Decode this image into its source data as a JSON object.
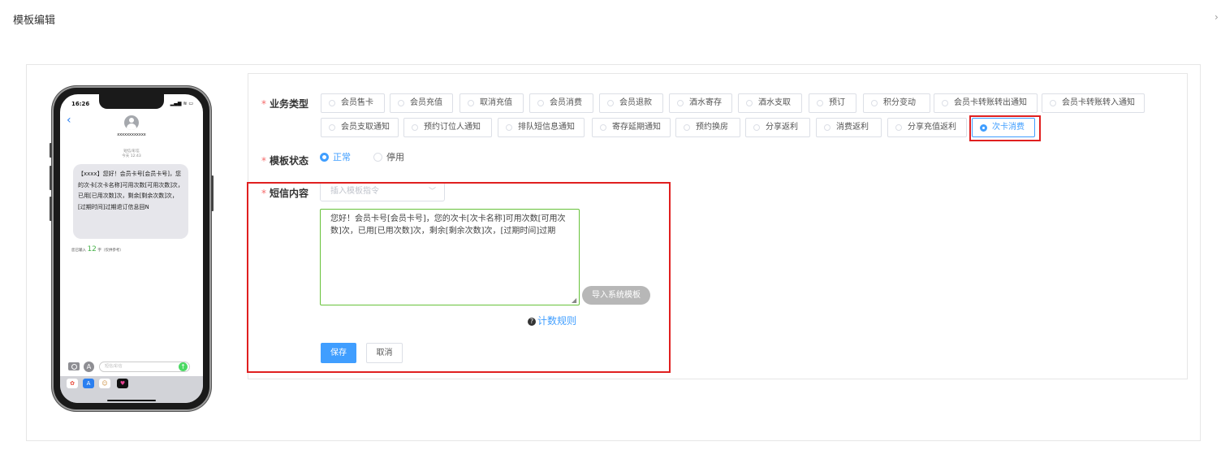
{
  "page": {
    "title": "模板编辑"
  },
  "preview": {
    "status_time": "16:26",
    "status_icons": "▂▄▆ ≋ ▭",
    "contact_name": "xxxxxxxxxxxx",
    "sms_meta_line1": "短信/彩信",
    "sms_meta_line2": "今天 12:43",
    "message": "【xxxx】您好！会员卡号[会员卡号]，您的次卡[次卡名称]可用次数[可用次数]次，已用[已用次数]次，剩余[剩余次数]次，[过期时间]过期退订信息回N",
    "counter_prefix": "您已输入",
    "counter_value": "12",
    "counter_suffix": "字（仅供参考）",
    "input_placeholder": "短信/彩信"
  },
  "form": {
    "business_type": {
      "label": "业务类型",
      "options": [
        "会员售卡",
        "会员充值",
        "取消充值",
        "会员消费",
        "会员退款",
        "酒水寄存",
        "酒水支取",
        "预订",
        "积分变动",
        "会员卡转账转出通知",
        "会员卡转账转入通知",
        "会员支取通知",
        "预约订位人通知",
        "排队短信息通知",
        "寄存延期通知",
        "预约换房",
        "分享返利",
        "消费返利",
        "分享充值返利",
        "次卡消费"
      ],
      "selected": "次卡消费"
    },
    "template_status": {
      "label": "模板状态",
      "options": [
        "正常",
        "停用"
      ],
      "selected": "正常"
    },
    "sms_content": {
      "label": "短信内容",
      "insert_placeholder": "插入模板指令",
      "text": "您好！会员卡号[会员卡号]，您的次卡[次卡名称]可用次数[可用次数]次，已用[已用次数]次，剩余[剩余次数]次，[过期时间]过期",
      "import_button": "导入系统模板",
      "rules_link": "计数规则"
    },
    "save_label": "保存",
    "cancel_label": "取消"
  },
  "colors": {
    "accent": "#409eff",
    "highlight": "#e02020",
    "required": "#f56c6c",
    "textarea_border": "#67c23a"
  }
}
